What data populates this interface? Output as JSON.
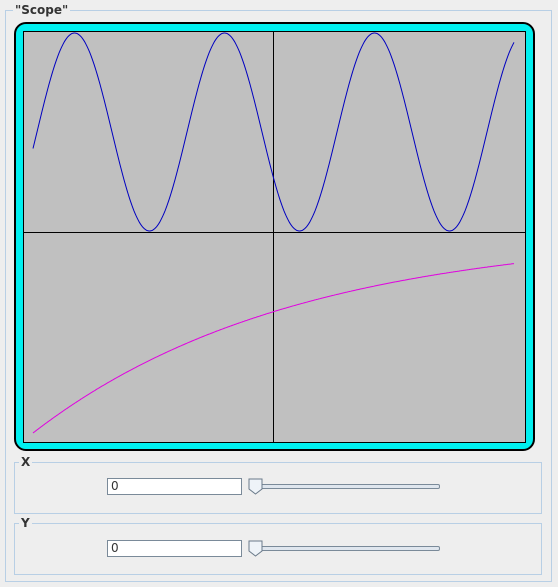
{
  "window": {
    "title": "\"Scope\""
  },
  "scope": {
    "colors": {
      "frame": "#00f0f0",
      "plot_background": "#c0c0c0",
      "crosshair": "#000000",
      "trace_1": "#0000c0",
      "trace_2": "#e000e0"
    },
    "traces": [
      {
        "id": "sine",
        "samples": 1.5,
        "amplitude": 1.0
      },
      {
        "id": "exponential",
        "shape": "rising-saturating"
      }
    ]
  },
  "x_control": {
    "label": "X",
    "value": "0",
    "slider_fraction": 0.0
  },
  "y_control": {
    "label": "Y",
    "value": "0",
    "slider_fraction": 0.0
  }
}
